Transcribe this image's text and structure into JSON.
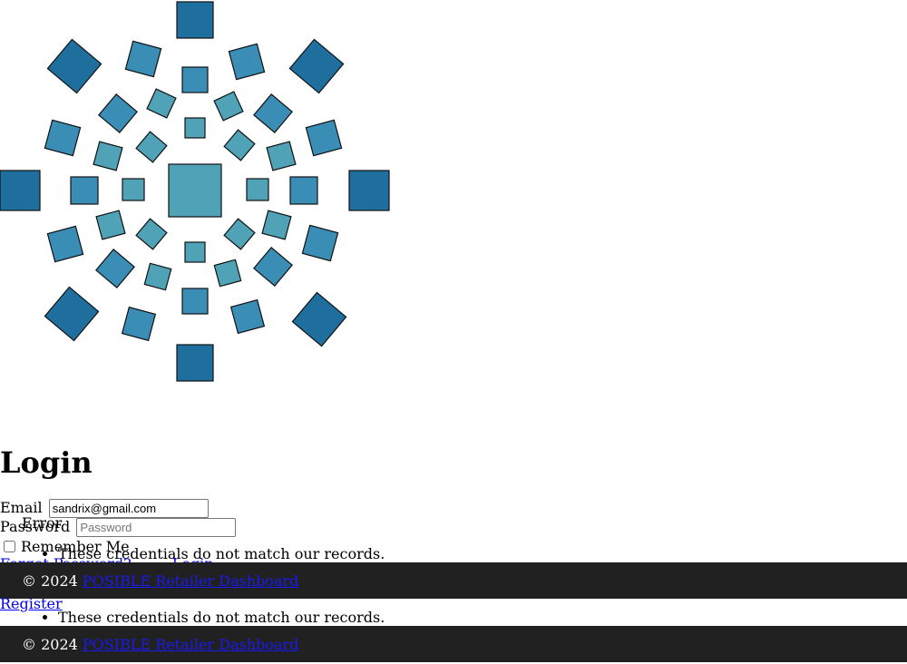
{
  "page": {
    "title": "Login"
  },
  "form": {
    "email_label": "Email",
    "email_value": "sandrix@gmail.com",
    "password_label": "Password",
    "password_placeholder": "Password",
    "remember_label": "Remember Me",
    "forgot_link": "Forgot Password?",
    "login_button": "Login",
    "register_link": "Register"
  },
  "errors": {
    "heading": "Error",
    "messages": [
      "These credentials do not match our records."
    ]
  },
  "footer": {
    "copyright": "© 2024",
    "link_text": "POSIBLE Retailer Dashboard"
  },
  "colors": {
    "logo_dark": "#1f6f9e",
    "logo_mid": "#3a8db5",
    "logo_light": "#50a3b6",
    "footer_bg": "#212121"
  }
}
